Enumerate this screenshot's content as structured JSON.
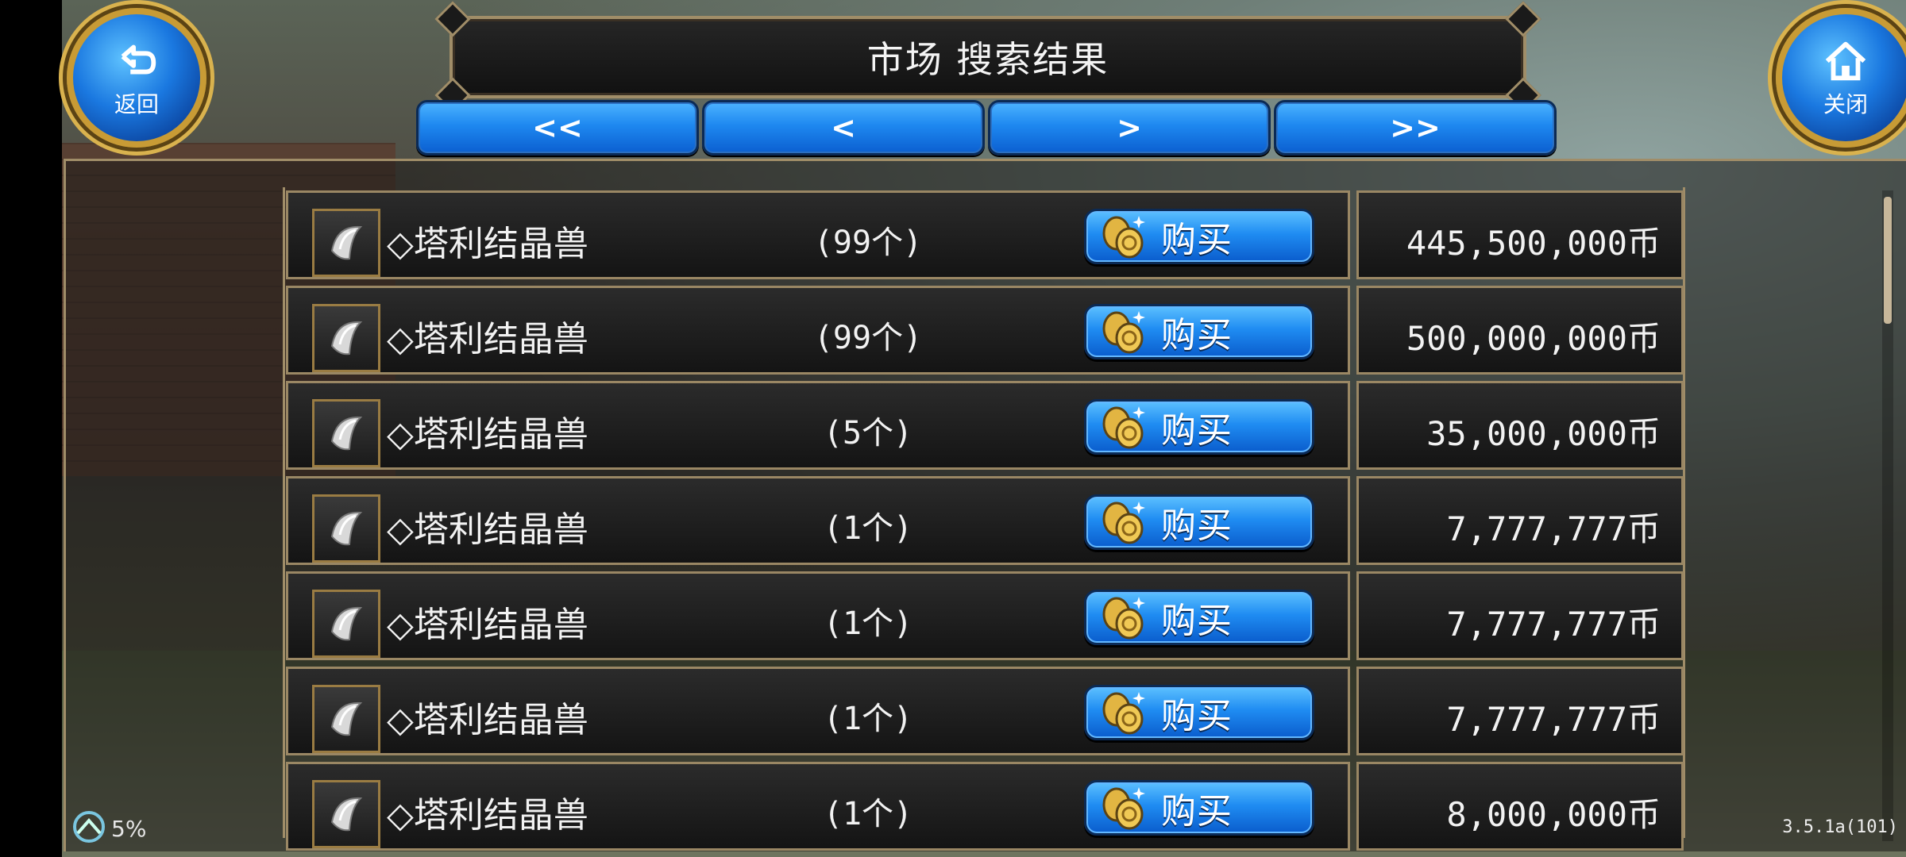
{
  "header": {
    "title": "市场  搜索结果",
    "back_label": "返回",
    "close_label": "关闭"
  },
  "pagination": {
    "first": "<<",
    "prev": "<",
    "next": ">",
    "last": ">>"
  },
  "rows": [
    {
      "name": "◇塔利结晶兽",
      "qty": "(99个)",
      "buy": "购买",
      "price": "445,500,000币"
    },
    {
      "name": "◇塔利结晶兽",
      "qty": "(99个)",
      "buy": "购买",
      "price": "500,000,000币"
    },
    {
      "name": "◇塔利结晶兽",
      "qty": "(5个)",
      "buy": "购买",
      "price": "35,000,000币"
    },
    {
      "name": "◇塔利结晶兽",
      "qty": "(1个)",
      "buy": "购买",
      "price": "7,777,777币"
    },
    {
      "name": "◇塔利结晶兽",
      "qty": "(1个)",
      "buy": "购买",
      "price": "7,777,777币"
    },
    {
      "name": "◇塔利结晶兽",
      "qty": "(1个)",
      "buy": "购买",
      "price": "7,777,777币"
    },
    {
      "name": "◇塔利结晶兽",
      "qty": "(1个)",
      "buy": "购买",
      "price": "8,000,000币"
    }
  ],
  "status": {
    "load_percent": "5%",
    "version": "3.5.1a(101)"
  },
  "icons": {
    "item": "crystal-shard-icon",
    "buy": "gold-coins-icon",
    "back": "return-arrow-icon",
    "close": "home-icon"
  },
  "colors": {
    "button_blue": "#1e88f0",
    "frame_gold": "#a08d68"
  }
}
